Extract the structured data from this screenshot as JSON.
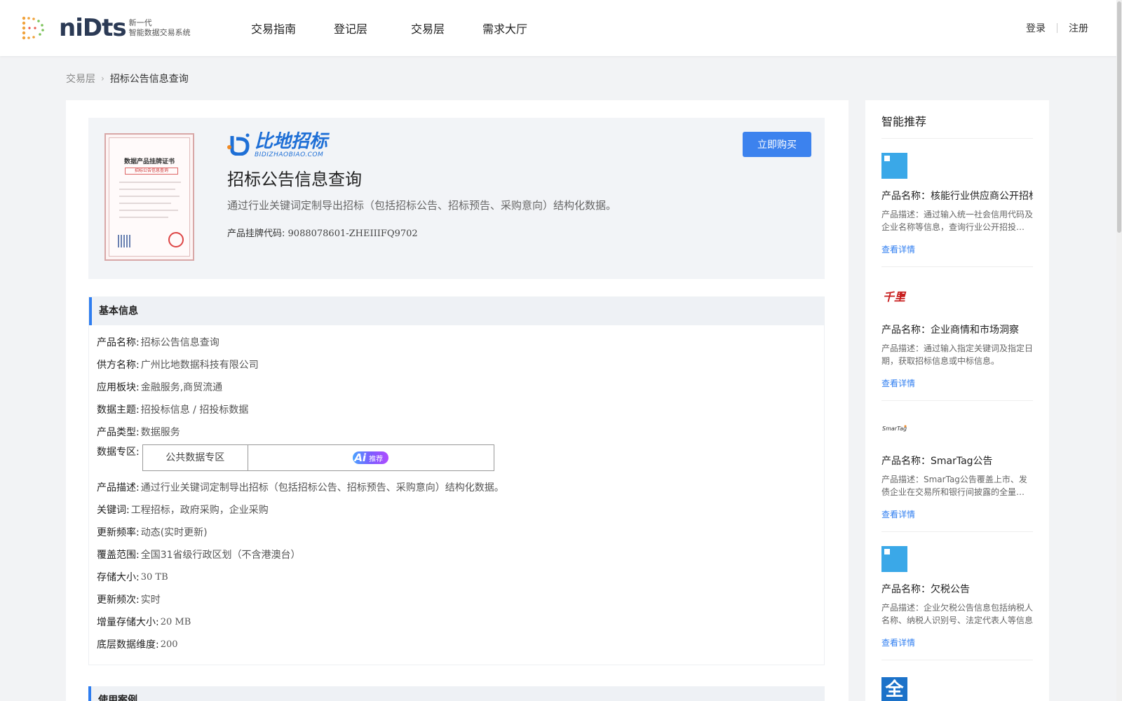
{
  "header": {
    "logo_word": "niDts",
    "logo_sub_1": "新一代",
    "logo_sub_2": "智能数据交易系统",
    "nav": [
      "交易指南",
      "登记层",
      "交易层",
      "需求大厅"
    ],
    "login": "登录",
    "register": "注册"
  },
  "breadcrumb": {
    "parent": "交易层",
    "current": "招标公告信息查询"
  },
  "hero": {
    "cert_title": "数据产品挂牌证书",
    "cert_subtitle": "招标公告信息查询",
    "brand_cn": "比地招标",
    "brand_en": "BIDIZHAOBIAO.COM",
    "title": "招标公告信息查询",
    "description": "通过行业关键词定制导出招标（包括招标公告、招标预告、采购意向）结构化数据。",
    "code_label": "产品挂牌代码:",
    "code_value": "9088078601-ZHEIIIFQ9702",
    "buy_button": "立即购买"
  },
  "basic_info": {
    "heading": "基本信息",
    "rows": [
      {
        "label": "产品名称:",
        "value": "招标公告信息查询"
      },
      {
        "label": "供方名称:",
        "value": "广州比地数据科技有限公司"
      },
      {
        "label": "应用板块:",
        "value": "金融服务,商贸流通"
      },
      {
        "label": "数据主题:",
        "value": "招投标信息 / 招投标数据"
      },
      {
        "label": "产品类型:",
        "value": "数据服务"
      }
    ],
    "zone_label": "数据专区:",
    "zone_value": "公共数据专区",
    "ai_letters": "Ai",
    "ai_text": "推荐",
    "rows2": [
      {
        "label": "产品描述:",
        "value": "通过行业关键词定制导出招标（包括招标公告、招标预告、采购意向）结构化数据。"
      },
      {
        "label": "关键词:",
        "value": "工程招标，政府采购，企业采购"
      },
      {
        "label": "更新频率:",
        "value": "动态(实时更新)"
      },
      {
        "label": "覆盖范围:",
        "value": "全国31省级行政区划（不含港澳台）"
      },
      {
        "label": "存储大小:",
        "value": "30 TB"
      },
      {
        "label": "更新频次:",
        "value": "实时"
      },
      {
        "label": "增量存储大小:",
        "value": "20 MB"
      },
      {
        "label": "底层数据维度:",
        "value": "200"
      }
    ]
  },
  "use_cases": {
    "heading": "使用案例"
  },
  "sidebar": {
    "title": "智能推荐",
    "items": [
      {
        "name": "产品名称：核能行业供应商公开招标",
        "desc": "产品描述：通过输入统一社会信用代码及企业名称等信息，查询行业公开招投标信息",
        "link": "查看详情",
        "icon": "blue-square-icon"
      },
      {
        "name": "产品名称：企业商情和市场洞察",
        "desc": "产品描述：通过输入指定关键词及指定日期，获取招标信息或中标信息。",
        "link": "查看详情",
        "icon": "red-logo-icon"
      },
      {
        "name": "产品名称：SmarTag公告",
        "desc": "产品描述：SmarTag公告覆盖上市、发债企业在交易所和银行间披露的全量公告信息",
        "link": "查看详情",
        "icon": "smartag-logo-icon"
      },
      {
        "name": "产品名称：欠税公告",
        "desc": "产品描述：企业欠税公告信息包括纳税人名称、纳税人识别号、法定代表人等信息",
        "link": "查看详情",
        "icon": "blue-square-icon"
      }
    ],
    "next_icon_char": "全"
  }
}
